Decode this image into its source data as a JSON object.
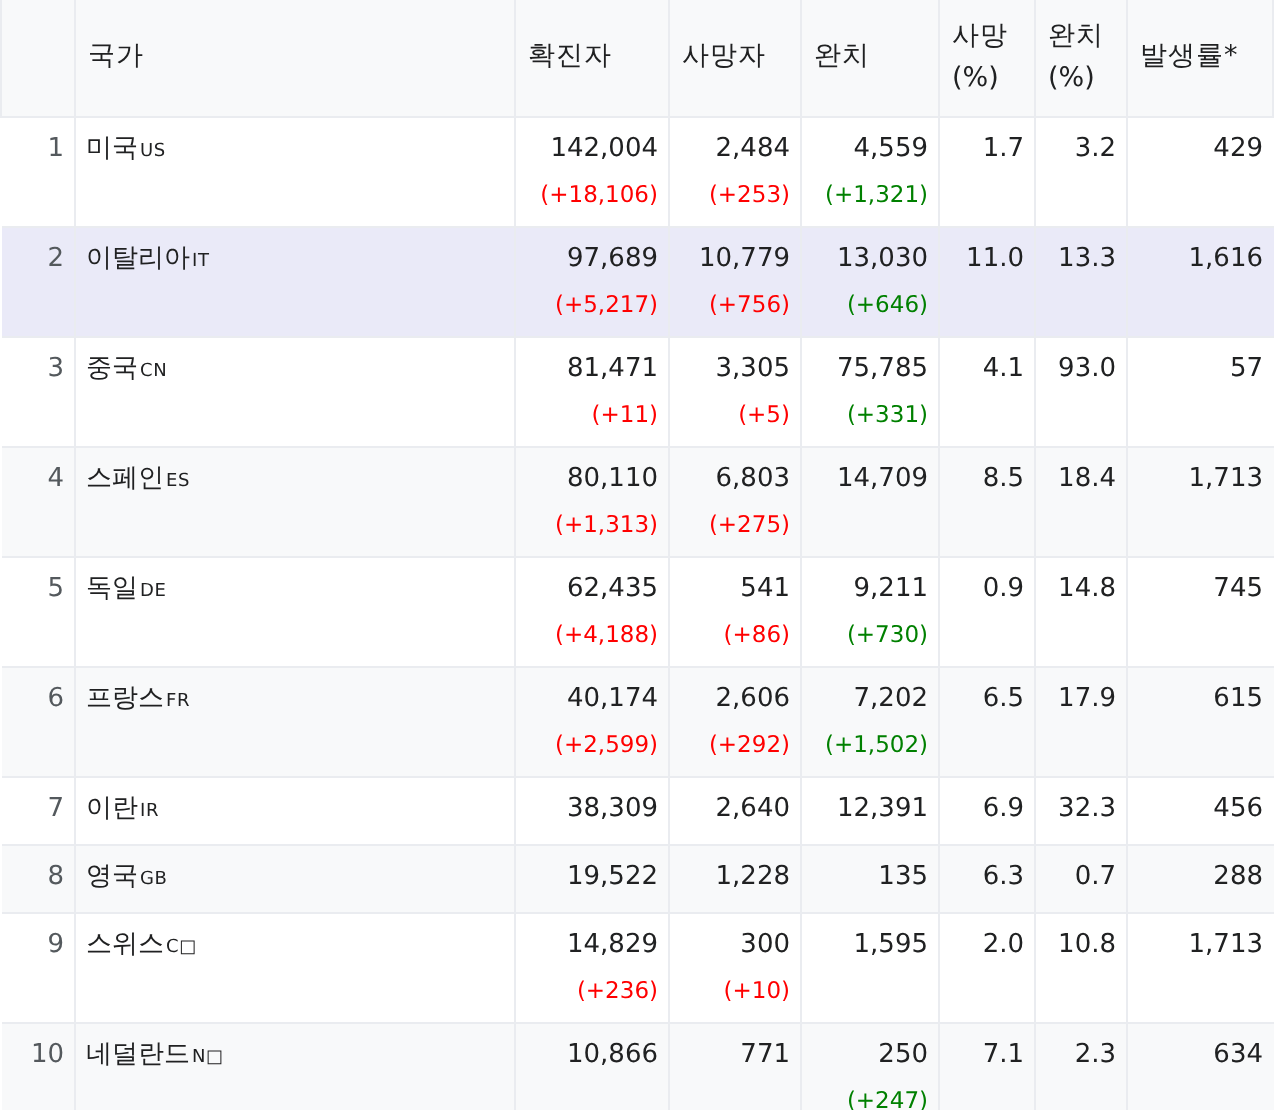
{
  "table": {
    "columns": [
      "국가",
      "확진자",
      "사망자",
      "완치",
      "사망 (%)",
      "완치 (%)",
      "발생률*"
    ],
    "rows": [
      {
        "rank": "1",
        "country": "미국",
        "code": "US",
        "selected": false,
        "confirmed": "142,004",
        "confirmed_change": "(+18,106)",
        "deaths": "2,484",
        "deaths_change": "(+253)",
        "recovered": "4,559",
        "recovered_change": "(+1,321)",
        "death_rate": "1.7",
        "recovery_rate": "3.2",
        "incidence": "429"
      },
      {
        "rank": "2",
        "country": "이탈리아",
        "code": "IT",
        "selected": true,
        "confirmed": "97,689",
        "confirmed_change": "(+5,217)",
        "deaths": "10,779",
        "deaths_change": "(+756)",
        "recovered": "13,030",
        "recovered_change": "(+646)",
        "death_rate": "11.0",
        "recovery_rate": "13.3",
        "incidence": "1,616"
      },
      {
        "rank": "3",
        "country": "중국",
        "code": "CN",
        "selected": false,
        "confirmed": "81,471",
        "confirmed_change": "(+11)",
        "deaths": "3,305",
        "deaths_change": "(+5)",
        "recovered": "75,785",
        "recovered_change": "(+331)",
        "death_rate": "4.1",
        "recovery_rate": "93.0",
        "incidence": "57"
      },
      {
        "rank": "4",
        "country": "스페인",
        "code": "ES",
        "selected": false,
        "confirmed": "80,110",
        "confirmed_change": "(+1,313)",
        "deaths": "6,803",
        "deaths_change": "(+275)",
        "recovered": "14,709",
        "death_rate": "8.5",
        "recovery_rate": "18.4",
        "incidence": "1,713"
      },
      {
        "rank": "5",
        "country": "독일",
        "code": "DE",
        "selected": false,
        "confirmed": "62,435",
        "confirmed_change": "(+4,188)",
        "deaths": "541",
        "deaths_change": "(+86)",
        "recovered": "9,211",
        "recovered_change": "(+730)",
        "death_rate": "0.9",
        "recovery_rate": "14.8",
        "incidence": "745"
      },
      {
        "rank": "6",
        "country": "프랑스",
        "code": "FR",
        "selected": false,
        "confirmed": "40,174",
        "confirmed_change": "(+2,599)",
        "deaths": "2,606",
        "deaths_change": "(+292)",
        "recovered": "7,202",
        "recovered_change": "(+1,502)",
        "death_rate": "6.5",
        "recovery_rate": "17.9",
        "incidence": "615"
      },
      {
        "rank": "7",
        "country": "이란",
        "code": "IR",
        "selected": false,
        "confirmed": "38,309",
        "deaths": "2,640",
        "recovered": "12,391",
        "death_rate": "6.9",
        "recovery_rate": "32.3",
        "incidence": "456"
      },
      {
        "rank": "8",
        "country": "영국",
        "code": "GB",
        "selected": false,
        "confirmed": "19,522",
        "deaths": "1,228",
        "recovered": "135",
        "death_rate": "6.3",
        "recovery_rate": "0.7",
        "incidence": "288"
      },
      {
        "rank": "9",
        "country": "스위스",
        "code": "C□",
        "selected": false,
        "confirmed": "14,829",
        "confirmed_change": "(+236)",
        "deaths": "300",
        "deaths_change": "(+10)",
        "recovered": "1,595",
        "death_rate": "2.0",
        "recovery_rate": "10.8",
        "incidence": "1,713"
      },
      {
        "rank": "10",
        "country": "네덜란드",
        "code": "N□",
        "selected": false,
        "confirmed": "10,866",
        "deaths": "771",
        "recovered": "250",
        "recovered_change": "(+247)",
        "death_rate": "7.1",
        "recovery_rate": "2.3",
        "incidence": "634"
      }
    ]
  }
}
